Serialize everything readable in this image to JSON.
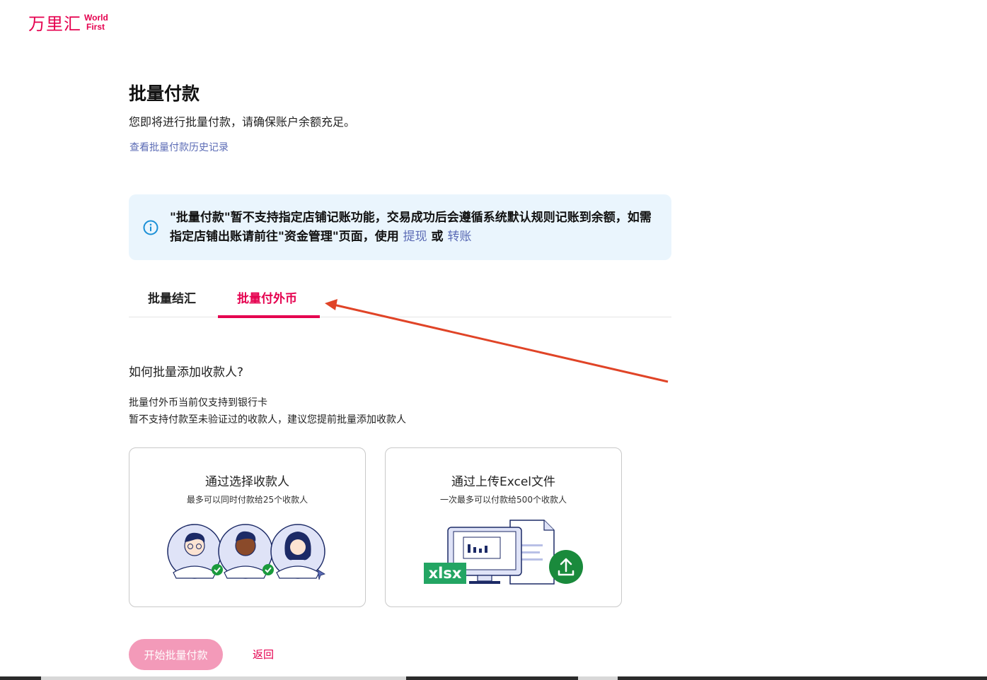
{
  "brand": {
    "name_cn": "万里汇",
    "name_en_1": "World",
    "name_en_2": "First"
  },
  "page": {
    "title": "批量付款",
    "subtitle": "您即将进行批量付款，请确保账户余额充足。",
    "history_link": "查看批量付款历史记录"
  },
  "notice": {
    "text": "\"批量付款\"暂不支持指定店铺记账功能，交易成功后会遵循系统默认规则记账到余额，如需指定店铺出账请前往\"资金管理\"页面，使用 ",
    "link_withdraw": "提现",
    "connector": " 或 ",
    "link_transfer": "转账"
  },
  "tabs": [
    {
      "label": "批量结汇",
      "active": false
    },
    {
      "label": "批量付外币",
      "active": true
    }
  ],
  "howto": {
    "title": "如何批量添加收款人?",
    "line1": "批量付外币当前仅支持到银行卡",
    "line2": "暂不支持付款至未验证过的收款人，建议您提前批量添加收款人"
  },
  "cards": [
    {
      "title": "通过选择收款人",
      "subtitle": "最多可以同时付款给25个收款人"
    },
    {
      "title": "通过上传Excel文件",
      "subtitle": "一次最多可以付款给500个收款人",
      "badge": "xlsx"
    }
  ],
  "actions": {
    "start_label": "开始批量付款",
    "back_label": "返回"
  },
  "colors": {
    "brand": "#e5004f",
    "link": "#5b6bb5",
    "notice_bg": "#eaf5fd",
    "button_disabled": "#f39ab9",
    "success": "#1a9a3c"
  }
}
